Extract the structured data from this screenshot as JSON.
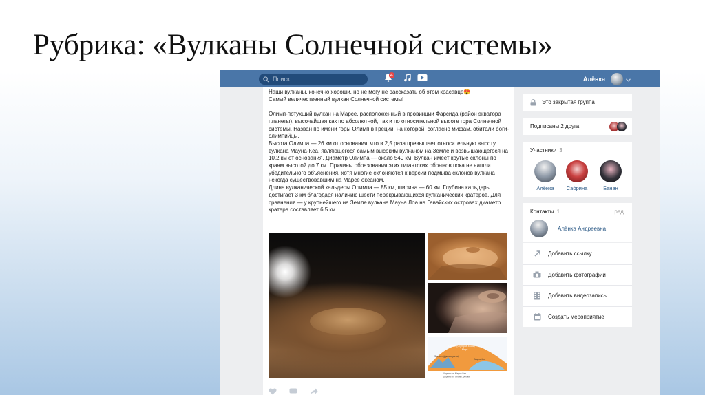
{
  "slide": {
    "title": "Рубрика: «Вулканы Солнечной системы»"
  },
  "header": {
    "search_placeholder": "Поиск",
    "notification_count": "4",
    "user_name": "Алёнка",
    "icons": [
      "search-icon",
      "bell-icon",
      "music-icon",
      "video-icon",
      "chevron-down-icon"
    ]
  },
  "post": {
    "paragraphs": [
      "Наши вулканы, конечно хороши, но не могу не рассказать об этом красавце😍",
      "Самый величественный вулкан Солнечной системы!",
      "",
      "Олимп-потухший вулкан на Марсе, расположенный в провинции Фарсида (район экватора планеты), высочайшая как по абсолютной, так и по относительной высоте гора Солнечной системы. Назван по имени горы Олимп в Греции, на которой, согласно мифам, обитали боги-олимпийцы.",
      "Высота Олимпа — 26 км от основания, что в 2,5 раза превышает относительную высоту вулкана Мауна-Кеа, являющегося самым высоким вулканом на Земле и возвышающегося на 10,2 км от основания. Диаметр Олимпа — около 540 км. Вулкан имеет крутые склоны по краям высотой до 7 км. Причины образования этих гигантских обрывов пока не нашли убедительного объяснения, хотя многие склоняются к версии подмыва склонов вулкана некогда существовавшим на Марсе океаном.",
      "Длина вулканической кальдеры Олимпа — 85 км, ширина — 60 км. Глубина кальдеры достигает 3 км благодаря наличию шести перекрывающихся вулканических кратеров. Для сравнения — у крупнейшего на Земле вулкана Мауна Лоа на Гавайских островах диаметр кратера составляет 6,5 км."
    ],
    "diagram_labels": {
      "olympus": "Олимп (Olympus Mons)",
      "olympus_sub": "Марс",
      "everest": "Эверест (Джомолунгма)",
      "mauna": "Мауна-Кеа",
      "width_1": "Ширина вл. Мауна-Кеа",
      "width_2": "Ширина вл. Олимп: 600 км"
    }
  },
  "sidebar": {
    "closed_group": "Это закрытая группа",
    "subscribed_friends": "Подписаны 2 друга",
    "members": {
      "title": "Участники",
      "count": "3",
      "items": [
        {
          "name": "Алёнка"
        },
        {
          "name": "Сабрина"
        },
        {
          "name": "Банан"
        }
      ]
    },
    "contacts": {
      "title": "Контакты",
      "count": "1",
      "edit": "ред.",
      "name": "Алёнка Андреевна"
    },
    "actions": [
      {
        "label": "Добавить ссылку",
        "icon": "link-icon"
      },
      {
        "label": "Добавить фотографии",
        "icon": "camera-icon"
      },
      {
        "label": "Добавить видеозапись",
        "icon": "film-icon"
      },
      {
        "label": "Создать мероприятие",
        "icon": "calendar-icon"
      }
    ]
  },
  "colors": {
    "header_blue": "#4a76a8",
    "link_blue": "#2a5885",
    "page_gray": "#edeef0"
  }
}
